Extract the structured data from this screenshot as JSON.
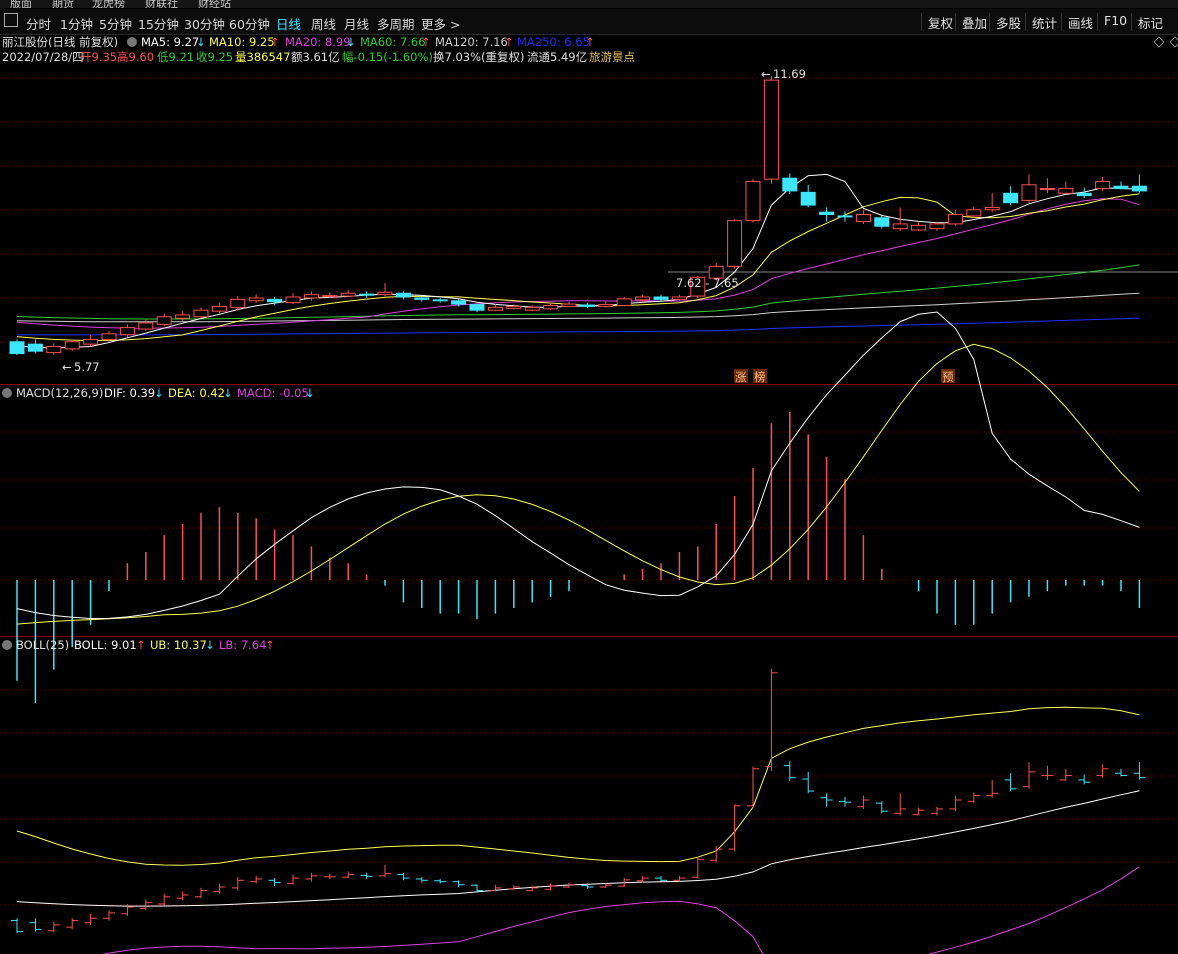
{
  "menubar": [
    "版面",
    "期货",
    "龙虎榜",
    "财联社",
    "财经站"
  ],
  "toolbar": {
    "periods": [
      "分时",
      "1分钟",
      "5分钟",
      "15分钟",
      "30分钟",
      "60分钟",
      "日线",
      "周线",
      "月线",
      "多周期",
      "更多 >"
    ],
    "active": "日线",
    "right_buttons": [
      "复权",
      "叠加",
      "多股",
      "统计",
      "画线",
      "F10",
      "标记"
    ]
  },
  "colors": {
    "up": "#ff5050",
    "down": "#3ce6ff",
    "ma5": "#ffffff",
    "ma10": "#ffff50",
    "ma20": "#e040e0",
    "ma60": "#30d030",
    "ma120": "#d0d0d0",
    "ma250": "#2030ff",
    "grid": "#5a0000"
  },
  "kline": {
    "title": "丽江股份(日线 前复权)",
    "ma_legend": [
      {
        "label": "MA5: 9.27",
        "arrow": "↓"
      },
      {
        "label": "MA10: 9.25",
        "arrow": "↑"
      },
      {
        "label": "MA20: 8.99",
        "arrow": "↓"
      },
      {
        "label": "MA60: 7.66",
        "arrow": "↑"
      },
      {
        "label": "MA120: 7.16",
        "arrow": "↑"
      },
      {
        "label": "MA250: 6.65",
        "arrow": "↑"
      }
    ],
    "info": {
      "date": "2022/07/28/四",
      "open": "开9.35",
      "high": "高9.60",
      "low": "低9.21",
      "close": "收9.25",
      "volume": "量386547",
      "amount": "额3.61亿",
      "change": "幅-0.15(-1.60%)",
      "turnover": "换7.03%(重复权)",
      "float": "流通5.49亿",
      "concept": "旅游景点"
    },
    "high_label": "11.69",
    "low_label": "5.77",
    "range_label": "7.62 - 7.65",
    "marks": [
      "涨",
      "榜",
      "预"
    ]
  },
  "macd": {
    "title": "MACD(12,26,9)",
    "dif": "DIF: 0.39",
    "dif_arrow": "↓",
    "dea": "DEA: 0.42",
    "dea_arrow": "↓",
    "macd": "MACD: -0.05",
    "macd_arrow": "↓"
  },
  "boll": {
    "title": "BOLL(25)",
    "boll": "BOLL: 9.01",
    "boll_arrow": "↑",
    "ub": "UB: 10.37",
    "ub_arrow": "↓",
    "lb": "LB: 7.64",
    "lb_arrow": "↑"
  },
  "chart_data": {
    "type": "candlestick",
    "ylim": [
      5.6,
      11.9
    ],
    "candles": [
      [
        6.05,
        5.8,
        6.1,
        5.77
      ],
      [
        6.0,
        5.85,
        6.1,
        5.8
      ],
      [
        5.82,
        5.95,
        6.02,
        5.78
      ],
      [
        5.9,
        6.05,
        6.1,
        5.85
      ],
      [
        6.0,
        6.1,
        6.2,
        5.95
      ],
      [
        6.1,
        6.22,
        6.28,
        6.05
      ],
      [
        6.2,
        6.35,
        6.42,
        6.15
      ],
      [
        6.32,
        6.45,
        6.52,
        6.28
      ],
      [
        6.42,
        6.58,
        6.65,
        6.38
      ],
      [
        6.55,
        6.62,
        6.7,
        6.5
      ],
      [
        6.58,
        6.72,
        6.78,
        6.55
      ],
      [
        6.7,
        6.8,
        6.88,
        6.65
      ],
      [
        6.78,
        6.95,
        7.02,
        6.72
      ],
      [
        6.92,
        6.98,
        7.05,
        6.88
      ],
      [
        6.95,
        6.9,
        7.0,
        6.82
      ],
      [
        6.88,
        7.0,
        7.08,
        6.85
      ],
      [
        6.98,
        7.05,
        7.12,
        6.92
      ],
      [
        7.03,
        7.03,
        7.1,
        6.98
      ],
      [
        7.02,
        7.08,
        7.15,
        7.0
      ],
      [
        7.06,
        7.04,
        7.12,
        6.98
      ],
      [
        7.05,
        7.1,
        7.3,
        7.02
      ],
      [
        7.08,
        7.0,
        7.12,
        6.95
      ],
      [
        6.98,
        6.95,
        7.02,
        6.9
      ],
      [
        6.94,
        6.92,
        6.98,
        6.88
      ],
      [
        6.92,
        6.85,
        6.95,
        6.8
      ],
      [
        6.84,
        6.72,
        6.86,
        6.68
      ],
      [
        6.72,
        6.78,
        6.85,
        6.7
      ],
      [
        6.76,
        6.8,
        6.84,
        6.74
      ],
      [
        6.72,
        6.78,
        6.82,
        6.7
      ],
      [
        6.75,
        6.82,
        6.88,
        6.72
      ],
      [
        6.8,
        6.85,
        6.9,
        6.78
      ],
      [
        6.83,
        6.8,
        6.88,
        6.76
      ],
      [
        6.8,
        6.84,
        6.9,
        6.78
      ],
      [
        6.82,
        6.96,
        7.0,
        6.8
      ],
      [
        6.94,
        7.0,
        7.05,
        6.9
      ],
      [
        7.0,
        6.95,
        7.05,
        6.92
      ],
      [
        6.95,
        7.0,
        7.05,
        6.92
      ],
      [
        7.02,
        7.42,
        7.45,
        6.98
      ],
      [
        7.4,
        7.65,
        7.72,
        7.35
      ],
      [
        7.65,
        8.62,
        8.65,
        7.6
      ],
      [
        8.62,
        9.45,
        9.5,
        8.58
      ],
      [
        9.5,
        11.6,
        11.69,
        9.4
      ],
      [
        9.52,
        9.25,
        9.62,
        9.18
      ],
      [
        9.22,
        8.95,
        9.38,
        8.9
      ],
      [
        8.8,
        8.75,
        8.9,
        8.6
      ],
      [
        8.72,
        8.7,
        8.82,
        8.6
      ],
      [
        8.6,
        8.75,
        8.85,
        8.55
      ],
      [
        8.68,
        8.5,
        8.72,
        8.45
      ],
      [
        8.45,
        8.55,
        8.9,
        8.4
      ],
      [
        8.42,
        8.52,
        8.58,
        8.4
      ],
      [
        8.45,
        8.55,
        8.6,
        8.4
      ],
      [
        8.55,
        8.75,
        8.85,
        8.5
      ],
      [
        8.72,
        8.85,
        8.92,
        8.68
      ],
      [
        8.85,
        8.9,
        9.2,
        8.8
      ],
      [
        9.2,
        9.0,
        9.35,
        8.95
      ],
      [
        9.05,
        9.38,
        9.6,
        9.0
      ],
      [
        9.3,
        9.3,
        9.52,
        9.2
      ],
      [
        9.2,
        9.3,
        9.45,
        9.18
      ],
      [
        9.2,
        9.15,
        9.32,
        9.1
      ],
      [
        9.3,
        9.45,
        9.55,
        9.25
      ],
      [
        9.35,
        9.3,
        9.45,
        9.28
      ],
      [
        9.35,
        9.25,
        9.6,
        9.21
      ]
    ],
    "macd_bars": [
      -0.18,
      -0.22,
      -0.16,
      -0.12,
      -0.08,
      -0.02,
      0.03,
      0.05,
      0.08,
      0.1,
      0.12,
      0.13,
      0.12,
      0.11,
      0.09,
      0.08,
      0.06,
      0.04,
      0.03,
      0.01,
      -0.01,
      -0.04,
      -0.05,
      -0.06,
      -0.06,
      -0.07,
      -0.06,
      -0.05,
      -0.04,
      -0.03,
      -0.02,
      0.0,
      0.0,
      0.01,
      0.02,
      0.03,
      0.05,
      0.06,
      0.1,
      0.15,
      0.2,
      0.28,
      0.3,
      0.26,
      0.22,
      0.18,
      0.08,
      0.02,
      0.0,
      -0.02,
      -0.06,
      -0.08,
      -0.08,
      -0.06,
      -0.04,
      -0.03,
      -0.02,
      -0.01,
      -0.01,
      -0.01,
      -0.02,
      -0.05
    ]
  }
}
